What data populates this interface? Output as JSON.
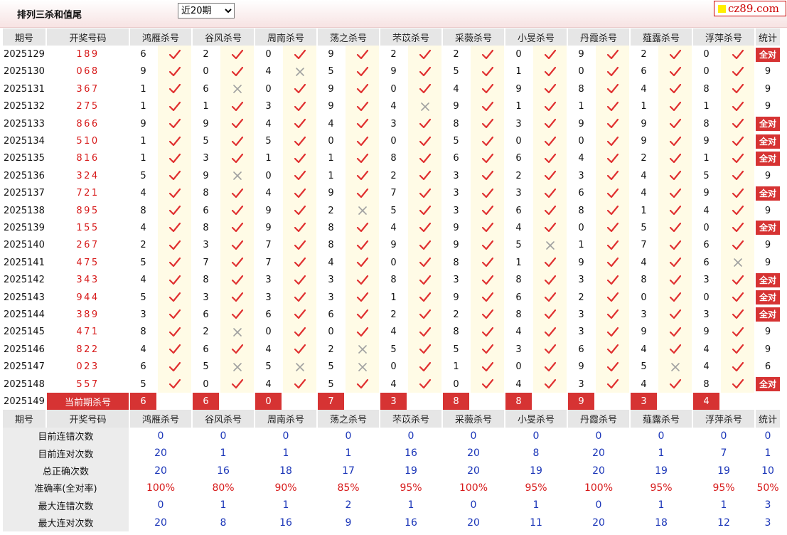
{
  "header": {
    "title": "排列三杀和值尾",
    "period_filter": "近20期",
    "period_options": [
      "近20期"
    ],
    "logo": "cz89.com"
  },
  "columns": {
    "period": "期号",
    "draw": "开奖号码",
    "experts": [
      "鸿雁杀号",
      "谷风杀号",
      "周南杀号",
      "荡之杀号",
      "芣苡杀号",
      "采薇杀号",
      "小旻杀号",
      "丹霞杀号",
      "薤露杀号",
      "浮萍杀号"
    ],
    "stat": "统计"
  },
  "rows": [
    {
      "period": "2025129",
      "draw": "189",
      "kills": [
        6,
        2,
        0,
        9,
        2,
        2,
        0,
        9,
        2,
        0
      ],
      "ok": [
        1,
        1,
        1,
        1,
        1,
        1,
        1,
        1,
        1,
        1
      ],
      "stat": "全对"
    },
    {
      "period": "2025130",
      "draw": "068",
      "kills": [
        9,
        0,
        4,
        5,
        9,
        5,
        1,
        0,
        6,
        0
      ],
      "ok": [
        1,
        1,
        0,
        1,
        1,
        1,
        1,
        1,
        1,
        1
      ],
      "stat": "9"
    },
    {
      "period": "2025131",
      "draw": "367",
      "kills": [
        1,
        6,
        0,
        9,
        0,
        4,
        9,
        8,
        4,
        8
      ],
      "ok": [
        1,
        0,
        1,
        1,
        1,
        1,
        1,
        1,
        1,
        1
      ],
      "stat": "9"
    },
    {
      "period": "2025132",
      "draw": "275",
      "kills": [
        1,
        1,
        3,
        9,
        4,
        9,
        1,
        1,
        1,
        1
      ],
      "ok": [
        1,
        1,
        1,
        1,
        0,
        1,
        1,
        1,
        1,
        1
      ],
      "stat": "9"
    },
    {
      "period": "2025133",
      "draw": "866",
      "kills": [
        9,
        9,
        4,
        4,
        3,
        8,
        3,
        9,
        9,
        8
      ],
      "ok": [
        1,
        1,
        1,
        1,
        1,
        1,
        1,
        1,
        1,
        1
      ],
      "stat": "全对"
    },
    {
      "period": "2025134",
      "draw": "510",
      "kills": [
        1,
        5,
        5,
        0,
        0,
        5,
        0,
        0,
        9,
        9
      ],
      "ok": [
        1,
        1,
        1,
        1,
        1,
        1,
        1,
        1,
        1,
        1
      ],
      "stat": "全对"
    },
    {
      "period": "2025135",
      "draw": "816",
      "kills": [
        1,
        3,
        1,
        1,
        8,
        6,
        6,
        4,
        2,
        1
      ],
      "ok": [
        1,
        1,
        1,
        1,
        1,
        1,
        1,
        1,
        1,
        1
      ],
      "stat": "全对"
    },
    {
      "period": "2025136",
      "draw": "324",
      "kills": [
        5,
        9,
        0,
        1,
        2,
        3,
        2,
        3,
        4,
        5
      ],
      "ok": [
        1,
        0,
        1,
        1,
        1,
        1,
        1,
        1,
        1,
        1
      ],
      "stat": "9"
    },
    {
      "period": "2025137",
      "draw": "721",
      "kills": [
        4,
        8,
        4,
        9,
        7,
        3,
        3,
        6,
        4,
        9
      ],
      "ok": [
        1,
        1,
        1,
        1,
        1,
        1,
        1,
        1,
        1,
        1
      ],
      "stat": "全对"
    },
    {
      "period": "2025138",
      "draw": "895",
      "kills": [
        8,
        6,
        9,
        2,
        5,
        3,
        6,
        8,
        1,
        4
      ],
      "ok": [
        1,
        1,
        1,
        0,
        1,
        1,
        1,
        1,
        1,
        1
      ],
      "stat": "9"
    },
    {
      "period": "2025139",
      "draw": "155",
      "kills": [
        4,
        8,
        9,
        8,
        4,
        9,
        4,
        0,
        5,
        0
      ],
      "ok": [
        1,
        1,
        1,
        1,
        1,
        1,
        1,
        1,
        1,
        1
      ],
      "stat": "全对"
    },
    {
      "period": "2025140",
      "draw": "267",
      "kills": [
        2,
        3,
        7,
        8,
        9,
        9,
        5,
        1,
        7,
        6
      ],
      "ok": [
        1,
        1,
        1,
        1,
        1,
        1,
        0,
        1,
        1,
        1
      ],
      "stat": "9"
    },
    {
      "period": "2025141",
      "draw": "475",
      "kills": [
        5,
        7,
        7,
        4,
        0,
        8,
        1,
        9,
        4,
        6
      ],
      "ok": [
        1,
        1,
        1,
        1,
        1,
        1,
        1,
        1,
        1,
        0
      ],
      "stat": "9"
    },
    {
      "period": "2025142",
      "draw": "343",
      "kills": [
        4,
        8,
        3,
        3,
        8,
        3,
        8,
        3,
        8,
        3
      ],
      "ok": [
        1,
        1,
        1,
        1,
        1,
        1,
        1,
        1,
        1,
        1
      ],
      "stat": "全对"
    },
    {
      "period": "2025143",
      "draw": "944",
      "kills": [
        5,
        3,
        3,
        3,
        1,
        9,
        6,
        2,
        0,
        0
      ],
      "ok": [
        1,
        1,
        1,
        1,
        1,
        1,
        1,
        1,
        1,
        1
      ],
      "stat": "全对"
    },
    {
      "period": "2025144",
      "draw": "389",
      "kills": [
        3,
        6,
        6,
        6,
        2,
        2,
        8,
        3,
        3,
        3
      ],
      "ok": [
        1,
        1,
        1,
        1,
        1,
        1,
        1,
        1,
        1,
        1
      ],
      "stat": "全对"
    },
    {
      "period": "2025145",
      "draw": "471",
      "kills": [
        8,
        2,
        0,
        0,
        4,
        8,
        4,
        3,
        9,
        9
      ],
      "ok": [
        1,
        0,
        1,
        1,
        1,
        1,
        1,
        1,
        1,
        1
      ],
      "stat": "9"
    },
    {
      "period": "2025146",
      "draw": "822",
      "kills": [
        4,
        6,
        4,
        2,
        5,
        5,
        3,
        6,
        4,
        4
      ],
      "ok": [
        1,
        1,
        1,
        0,
        1,
        1,
        1,
        1,
        1,
        1
      ],
      "stat": "9"
    },
    {
      "period": "2025147",
      "draw": "023",
      "kills": [
        6,
        5,
        5,
        5,
        0,
        1,
        0,
        9,
        5,
        4
      ],
      "ok": [
        1,
        0,
        0,
        0,
        1,
        1,
        1,
        1,
        0,
        1
      ],
      "stat": "6"
    },
    {
      "period": "2025148",
      "draw": "557",
      "kills": [
        5,
        0,
        4,
        5,
        4,
        0,
        4,
        3,
        4,
        8
      ],
      "ok": [
        1,
        1,
        1,
        1,
        1,
        1,
        1,
        1,
        1,
        1
      ],
      "stat": "全对"
    }
  ],
  "current": {
    "period": "2025149",
    "label": "当前期杀号",
    "kills": [
      6,
      6,
      0,
      7,
      3,
      8,
      8,
      9,
      3,
      4
    ]
  },
  "summary": [
    {
      "label": "目前连错次数",
      "values": [
        "0",
        "0",
        "0",
        "0",
        "0",
        "0",
        "0",
        "0",
        "0",
        "0"
      ],
      "stat": "0",
      "red": false
    },
    {
      "label": "目前连对次数",
      "values": [
        "20",
        "1",
        "1",
        "1",
        "16",
        "20",
        "8",
        "20",
        "1",
        "7"
      ],
      "stat": "1",
      "red": false
    },
    {
      "label": "总正确次数",
      "values": [
        "20",
        "16",
        "18",
        "17",
        "19",
        "20",
        "19",
        "20",
        "19",
        "19"
      ],
      "stat": "10",
      "red": false
    },
    {
      "label": "准确率(全对率)",
      "values": [
        "100%",
        "80%",
        "90%",
        "85%",
        "95%",
        "100%",
        "95%",
        "100%",
        "95%",
        "95%"
      ],
      "stat": "50%",
      "red": true
    },
    {
      "label": "最大连错次数",
      "values": [
        "0",
        "1",
        "1",
        "2",
        "1",
        "0",
        "1",
        "0",
        "1",
        "1"
      ],
      "stat": "3",
      "red": false
    },
    {
      "label": "最大连对次数",
      "values": [
        "20",
        "8",
        "16",
        "9",
        "16",
        "20",
        "11",
        "20",
        "18",
        "12"
      ],
      "stat": "3",
      "red": false
    }
  ],
  "colors": {
    "accent": "#d63333",
    "check": "#e03030",
    "cross": "#a0a0a0",
    "summary_blue": "#1a35b8",
    "draw_red": "#d71a1a"
  },
  "icons": {
    "correct": "check-icon",
    "wrong": "cross-icon"
  }
}
